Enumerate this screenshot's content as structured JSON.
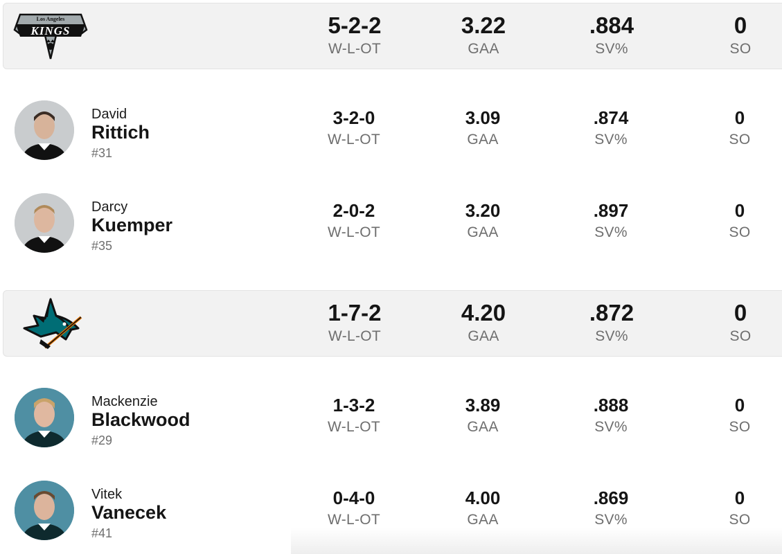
{
  "teams": [
    {
      "name": "Los Angeles Kings",
      "logo": "kings-logo",
      "logo_text": {
        "top": "Los Angeles",
        "main": "KINGS"
      },
      "record": "5-2-2",
      "record_label": "W-L-OT",
      "gaa": "3.22",
      "gaa_label": "GAA",
      "sv": ".884",
      "sv_label": "SV%",
      "so": "0",
      "so_label": "SO",
      "goalies": [
        {
          "first": "David",
          "last": "Rittich",
          "number": "#31",
          "record": "3-2-0",
          "gaa": "3.09",
          "sv": ".874",
          "so": "0"
        },
        {
          "first": "Darcy",
          "last": "Kuemper",
          "number": "#35",
          "record": "2-0-2",
          "gaa": "3.20",
          "sv": ".897",
          "so": "0"
        }
      ]
    },
    {
      "name": "San Jose Sharks",
      "logo": "sharks-logo",
      "record": "1-7-2",
      "record_label": "W-L-OT",
      "gaa": "4.20",
      "gaa_label": "GAA",
      "sv": ".872",
      "sv_label": "SV%",
      "so": "0",
      "so_label": "SO",
      "goalies": [
        {
          "first": "Mackenzie",
          "last": "Blackwood",
          "number": "#29",
          "record": "1-3-2",
          "gaa": "3.89",
          "sv": ".888",
          "so": "0"
        },
        {
          "first": "Vitek",
          "last": "Vanecek",
          "number": "#41",
          "record": "0-4-0",
          "gaa": "4.00",
          "sv": ".869",
          "so": "0"
        }
      ]
    }
  ],
  "labels": {
    "record": "W-L-OT",
    "gaa": "GAA",
    "sv": "SV%",
    "so": "SO"
  },
  "colors": {
    "kings_gray": "#a2aaad",
    "sharks_teal": "#006d75",
    "row_bg": "#f2f2f2"
  }
}
